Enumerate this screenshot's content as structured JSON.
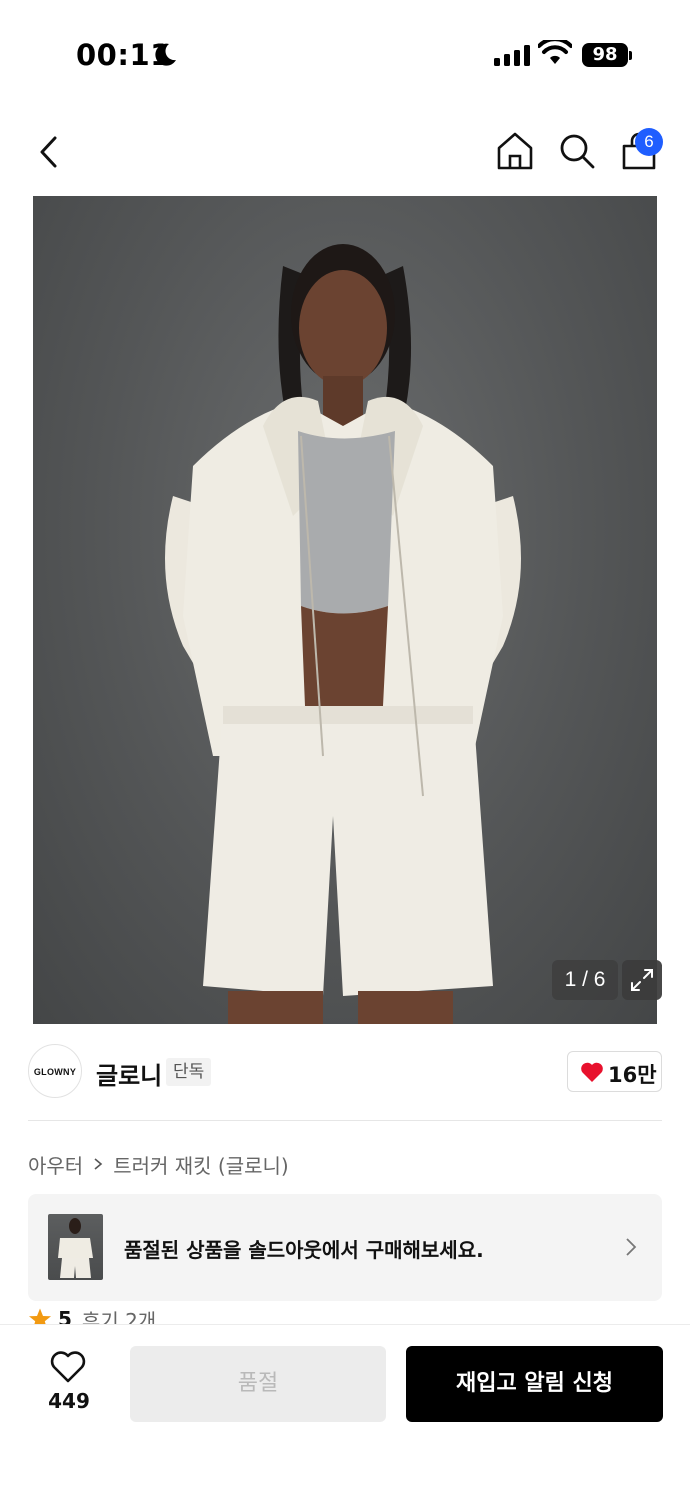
{
  "status_bar": {
    "time": "00:11",
    "battery": "98"
  },
  "nav": {
    "cart_count": "6"
  },
  "product_image": {
    "counter": "1 / 6"
  },
  "brand": {
    "logo_text": "GLOWNY",
    "name": "글로니",
    "tag": "단독",
    "likes": "16만"
  },
  "breadcrumb": {
    "category": "아우터",
    "product": "트러커 재킷 (글로니)"
  },
  "promo": {
    "text": "품절된 상품을 솔드아웃에서 구매해보세요."
  },
  "rating": {
    "score": "5",
    "reviews": "후기 2개"
  },
  "bottom_bar": {
    "wish_count": "449",
    "soldout_label": "품절",
    "restock_label": "재입고 알림 신청"
  },
  "colors": {
    "accent_blue": "#1f5eff",
    "heart_red": "#e8112d",
    "star_orange": "#f29a12",
    "primary_button": "#000000"
  }
}
